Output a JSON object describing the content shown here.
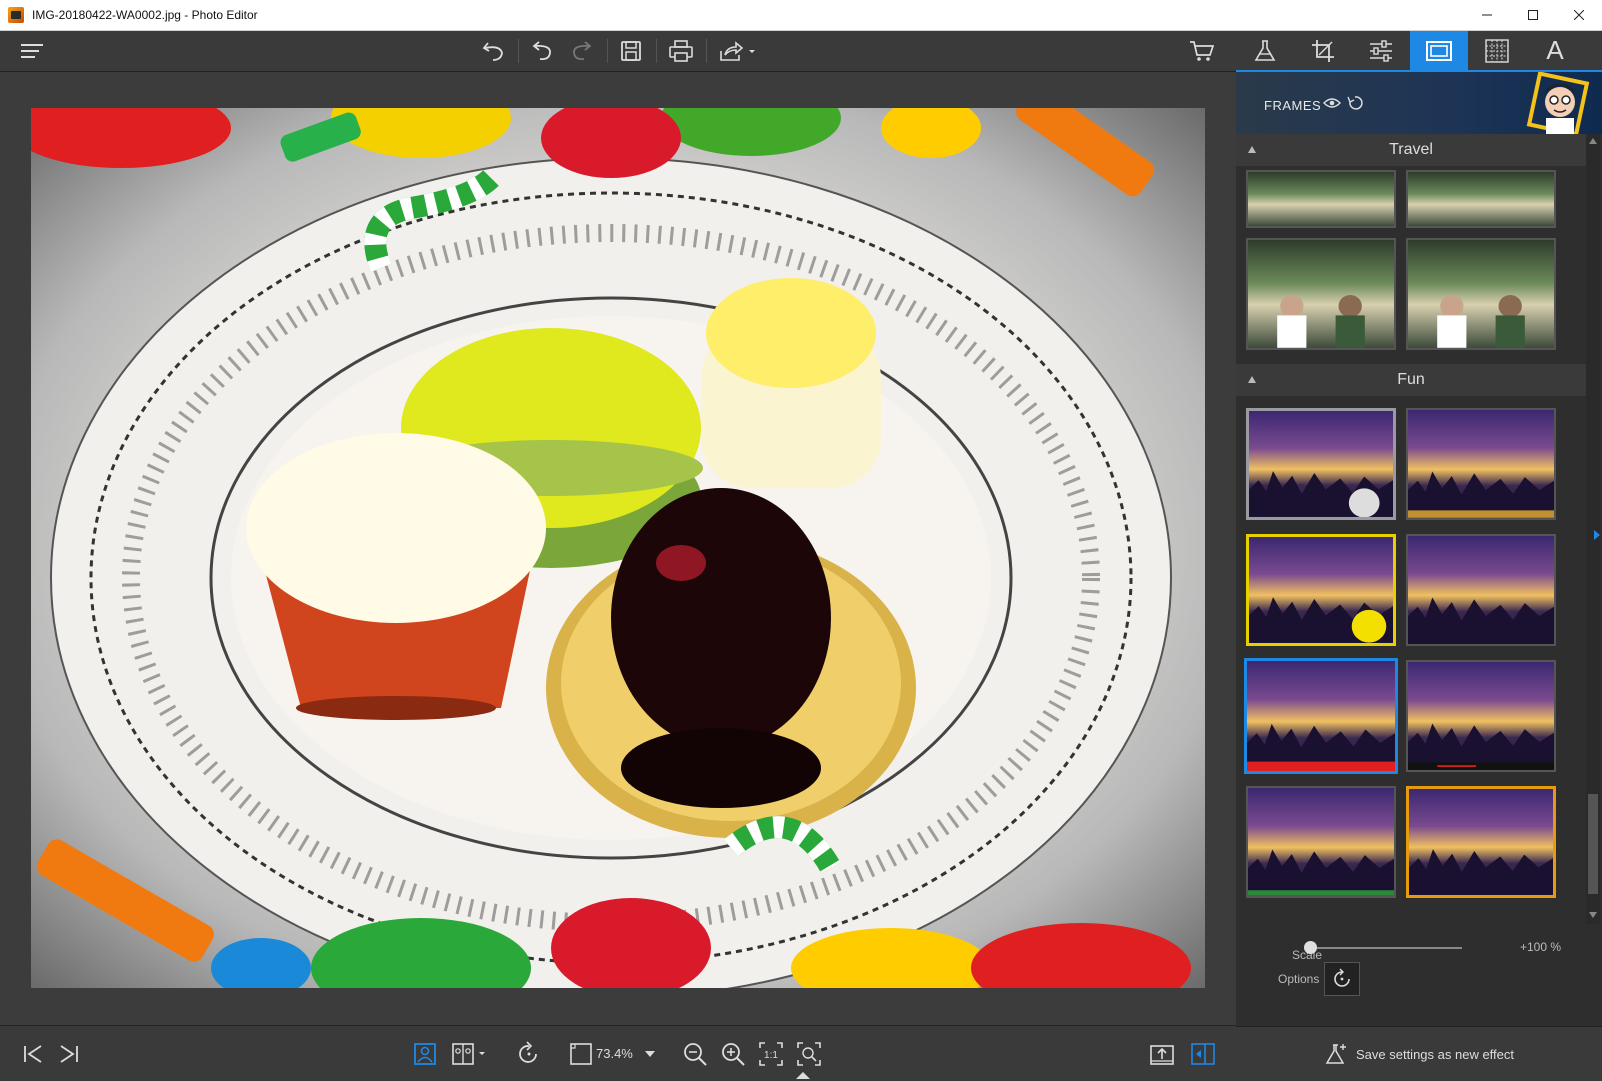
{
  "window": {
    "title": "IMG-20180422-WA0002.jpg - Photo Editor",
    "controls": [
      "minimize-icon",
      "maximize-icon",
      "close-icon"
    ]
  },
  "toolbar": {
    "icons": [
      "menu-icon",
      "undo-all-icon",
      "undo-icon",
      "redo-icon",
      "save-icon",
      "print-icon",
      "share-icon",
      "cart-icon"
    ]
  },
  "tabs": {
    "items": [
      "effects-tab",
      "crop-tab",
      "adjust-tab",
      "frames-tab",
      "texture-tab",
      "text-tab"
    ],
    "active": "frames-tab",
    "text_tab_label": "A"
  },
  "panel": {
    "header_title": "FRAMES",
    "sections": [
      {
        "name": "Travel"
      },
      {
        "name": "Fun"
      }
    ],
    "scale_label": "Scale",
    "scale_value": "+100 %",
    "scale_fraction": 0.0,
    "options_label": "Options",
    "save_effect_label": "Save settings as new effect"
  },
  "statusbar": {
    "zoom": "73.4%",
    "one_to_one": "1:1"
  },
  "colors": {
    "accent": "#1e88e5",
    "toolbar_bg": "#3a3a3a",
    "canvas_bg": "#3c3c3c",
    "panel_bg": "#2e2e2e"
  }
}
